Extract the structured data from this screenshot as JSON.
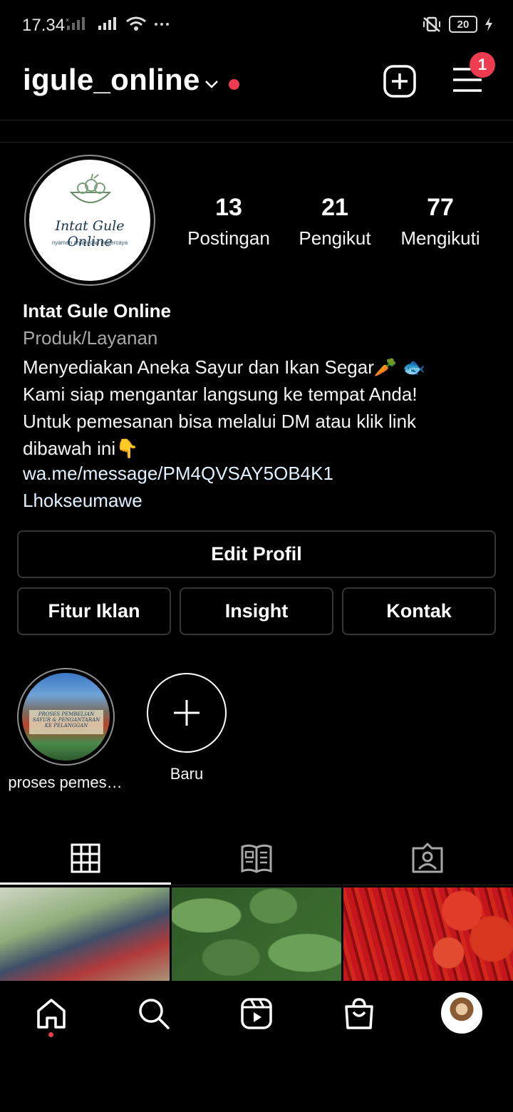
{
  "status_bar": {
    "time": "17.34",
    "battery": "20"
  },
  "header": {
    "username": "igule_online",
    "notification_count": "1"
  },
  "profile": {
    "logo_title": "Intat Gule Online",
    "logo_tagline": "nyaman aman dan terpercaya",
    "stats": [
      {
        "value": "13",
        "label": "Postingan"
      },
      {
        "value": "21",
        "label": "Pengikut"
      },
      {
        "value": "77",
        "label": "Mengikuti"
      }
    ],
    "full_name": "Intat Gule Online",
    "category": "Produk/Layanan",
    "bio": "Menyediakan Aneka Sayur dan Ikan Segar🥕 🐟\nKami siap mengantar langsung ke tempat Anda!\nUntuk pemesanan bisa melalui DM atau  klik link\ndibawah ini👇",
    "link": "wa.me/message/PM4QVSAY5OB4K1",
    "location": "Lhokseumawe"
  },
  "actions": {
    "edit_profile": "Edit Profil",
    "ads": "Fitur Iklan",
    "insight": "Insight",
    "contact": "Kontak"
  },
  "highlights": {
    "items": [
      {
        "label": "proses pemes…",
        "image_text": "PROSES PEMBELIAN SAYUR & PENGANTARAN KE PELANGGAN"
      }
    ],
    "new_label": "Baru"
  },
  "tabs": {
    "active": "grid",
    "icons": [
      "grid-icon",
      "guide-icon",
      "tagged-icon"
    ]
  },
  "bottom_nav": {
    "icons": [
      "home-icon",
      "search-icon",
      "reels-icon",
      "shop-icon",
      "profile-avatar"
    ],
    "active": "profile-avatar"
  },
  "colors": {
    "background": "#000000",
    "accent_red": "#ef3b4f",
    "link": "#e0f1ff",
    "secondary_text": "#a8a8a8",
    "border": "#363636"
  }
}
